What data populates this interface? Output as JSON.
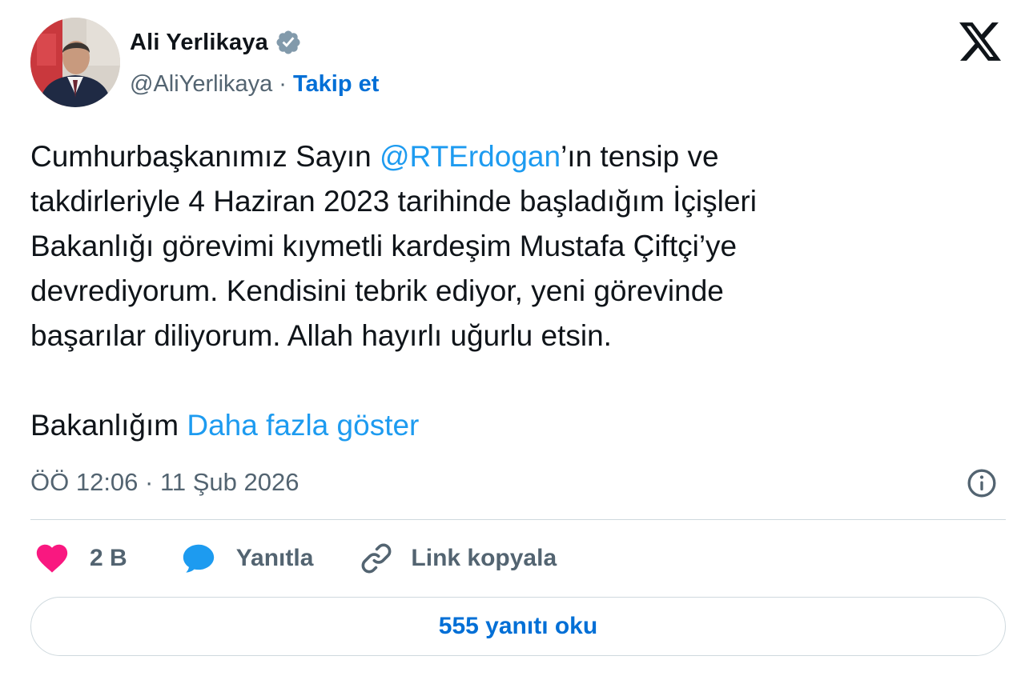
{
  "author": {
    "name": "Ali Yerlikaya",
    "handle": "@AliYerlikaya",
    "separator": "·",
    "follow_label": "Takip et",
    "verified_icon": "verified-badge-icon",
    "avatar": "profile-photo"
  },
  "platform_icon": "x-logo-icon",
  "tweet": {
    "lines": [
      {
        "before": "Cumhurbaşkanımız Sayın ",
        "mention": "@RTErdogan",
        "after": "’ın tensip ve"
      },
      {
        "text": "takdirleriyle 4 Haziran 2023 tarihinde başladığım İçişleri"
      },
      {
        "text": "Bakanlığı görevimi kıymetli kardeşim Mustafa Çiftçi’ye"
      },
      {
        "text": "devrediyorum. Kendisini tebrik ediyor, yeni görevinde"
      },
      {
        "text": "başarılar diliyorum. Allah hayırlı uğurlu etsin."
      }
    ],
    "last_line_text": "Bakanlığım ",
    "show_more_label": "Daha fazla göster"
  },
  "timestamp": "ÖÖ 12:06 · 11 Şub 2026",
  "actions": {
    "like_count": "2 B",
    "reply_label": "Yanıtla",
    "copy_link_label": "Link kopyala"
  },
  "read_replies_label": "555 yanıtı oku",
  "colors": {
    "text": "#0f1419",
    "secondary": "#536471",
    "link": "#1d9bf0",
    "button_blue": "#006fd6",
    "like": "#f91880",
    "divider": "#cfd9de"
  }
}
